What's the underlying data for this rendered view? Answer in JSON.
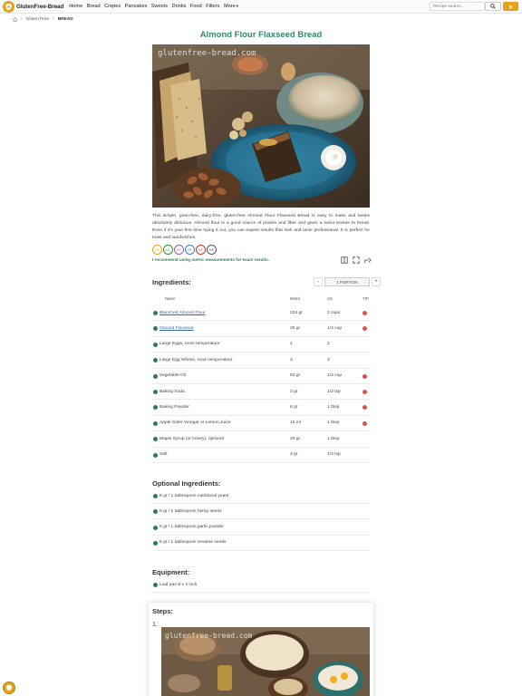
{
  "brand": {
    "name": "GlutenFree-Bread",
    "accent": "#e8a21a",
    "green": "#2f7a5f"
  },
  "nav": {
    "links": [
      "Home",
      "Bread",
      "Crepes",
      "Pancakes",
      "Sweets",
      "Drinks",
      "Food",
      "Filters"
    ],
    "more_label": "More",
    "search_placeholder": "Recipe search..."
  },
  "breadcrumb": {
    "items": [
      "Gluten Free",
      "BREAD"
    ]
  },
  "recipe": {
    "title": "Almond Flour Flaxseed Bread",
    "image_watermark": "glutenfree-bread.com",
    "intro": "This simple, grain-free, dairy-free, gluten-free Almond Flour Flaxseed Bread is easy to make and tastes absolutely delicious. Almond flour is a good source of protein and fiber and gives a moist texture to bread. Even if it's your first time trying it out, you can expect results that look and taste professional. It is perfect for toast and sandwiches.",
    "badges": [
      {
        "code": "GF",
        "color": "#e8a21a"
      },
      {
        "code": "LC",
        "color": "#2f8a3e"
      },
      {
        "code": "EF",
        "color": "#9b59b6"
      },
      {
        "code": "DF",
        "color": "#3a7bd5"
      },
      {
        "code": "VT",
        "color": "#c0392b"
      },
      {
        "code": "NF",
        "color": "#555555"
      }
    ],
    "metric_note": "I recommend using metric measurements for exact results."
  },
  "ingredients": {
    "title": "Ingredients:",
    "portion_label": "1 PORTION",
    "columns": {
      "name": "Name",
      "metric": "Metric",
      "us": "US",
      "tip": "TIP"
    },
    "rows": [
      {
        "name": "Blanched Almond Flour",
        "metric": "224 gr",
        "us": "2 cups",
        "link": true,
        "tip": true
      },
      {
        "name": "Ground Flaxseed",
        "metric": "30 gr",
        "us": "1/4 cup",
        "link": true,
        "tip": true
      },
      {
        "name": "Large Eggs, room temperature",
        "metric": "2",
        "us": "2",
        "link": false,
        "tip": false
      },
      {
        "name": "Large Egg Whites, room temperature",
        "metric": "3",
        "us": "3",
        "link": false,
        "tip": false
      },
      {
        "name": "Vegetable Oil",
        "metric": "50 gr",
        "us": "1/3 cup",
        "link": false,
        "tip": true
      },
      {
        "name": "Baking Soda",
        "metric": "3 gr",
        "us": "1/2 tsp",
        "link": false,
        "tip": true
      },
      {
        "name": "Baking Powder",
        "metric": "6 gr",
        "us": "1 tbsp",
        "link": false,
        "tip": true
      },
      {
        "name": "Apple Cider Vinegar or Lemon Juice",
        "metric": "15 ml",
        "us": "1 tbsp",
        "link": false,
        "tip": true
      },
      {
        "name": "Maple Syrup (or honey), optional",
        "metric": "20 gr",
        "us": "1 tbsp",
        "link": false,
        "tip": false
      },
      {
        "name": "Salt",
        "metric": "3 gr",
        "us": "1/2 tsp",
        "link": false,
        "tip": false
      }
    ]
  },
  "optional": {
    "title": "Optional Ingredients:",
    "items": [
      "6 gr / 1 tablespoon nutritional yeast",
      "6 gr / 1 tablespoon hemp seeds",
      "6 gr / 1 tablespoon garlic powder",
      "6 gr / 1 tablespoon sesame seeds"
    ]
  },
  "equipment": {
    "title": "Equipment:",
    "items": [
      "Loaf pan 8 x 4 inch"
    ]
  },
  "steps": {
    "title": "Steps:",
    "first_number": "1.",
    "image_watermark": "glutenfree-bread.com"
  }
}
